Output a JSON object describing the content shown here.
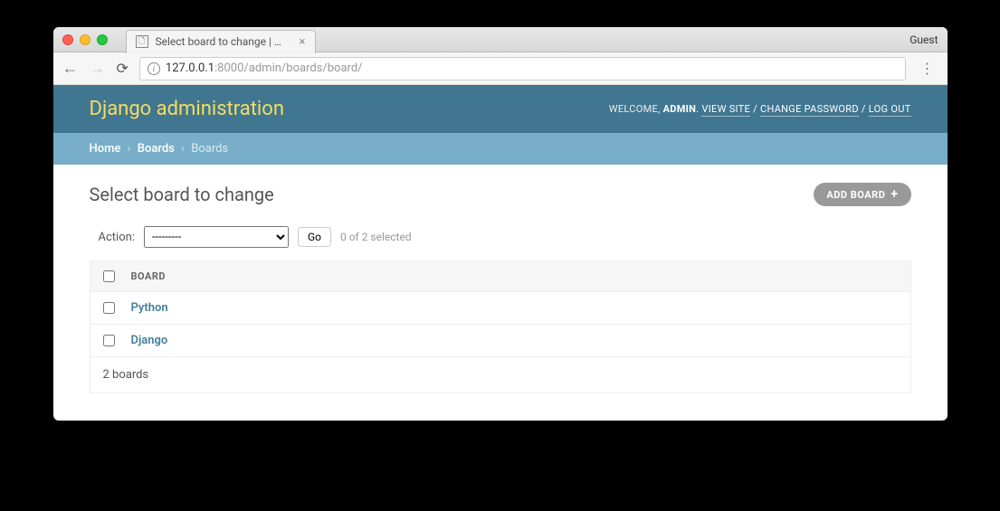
{
  "browser": {
    "tab_title": "Select board to change | Djang",
    "guest_label": "Guest",
    "url_host": "127.0.0.1",
    "url_port_path": ":8000/admin/boards/board/"
  },
  "header": {
    "brand": "Django administration",
    "welcome": "WELCOME,",
    "username": "ADMIN",
    "view_site": "VIEW SITE",
    "change_password": "CHANGE PASSWORD",
    "log_out": "LOG OUT"
  },
  "breadcrumbs": {
    "home": "Home",
    "app": "Boards",
    "model": "Boards"
  },
  "page": {
    "title": "Select board to change",
    "add_label": "ADD BOARD",
    "action_label": "Action:",
    "action_placeholder": "---------",
    "go_label": "Go",
    "selected_text": "0 of 2 selected",
    "column_header": "BOARD",
    "rows": [
      {
        "name": "Python"
      },
      {
        "name": "Django"
      }
    ],
    "footer": "2 boards"
  }
}
